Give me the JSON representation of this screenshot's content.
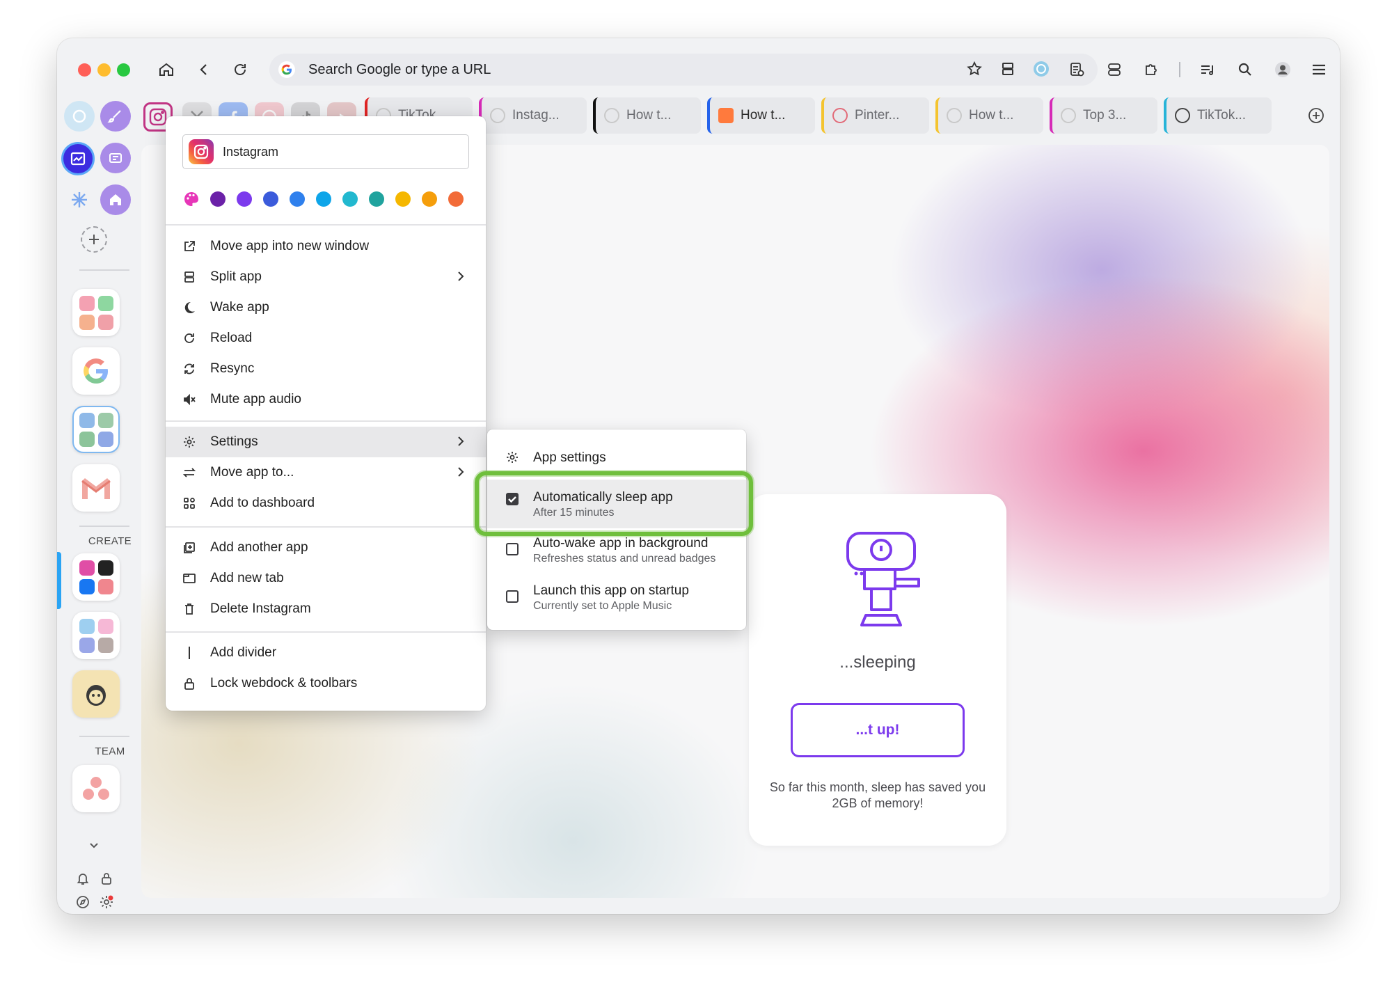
{
  "toolbar": {
    "omnibox_placeholder": "Search Google or type a URL"
  },
  "web_tabs": [
    {
      "label": "TikTok",
      "color": "#e02424"
    },
    {
      "label": "Instag...",
      "color": "#d62ab7"
    },
    {
      "label": "How t...",
      "color": "#111111"
    },
    {
      "label": "How t...",
      "color": "#2563eb"
    },
    {
      "label": "Pinter...",
      "color": "#f4c430"
    },
    {
      "label": "How t...",
      "color": "#f4c430"
    },
    {
      "label": "Top 3...",
      "color": "#d62ab7"
    },
    {
      "label": "TikTok...",
      "color": "#27b4d8"
    }
  ],
  "dock": {
    "create_label": "CREATE",
    "team_label": "TEAM"
  },
  "sleep_card": {
    "title": "...sleeping",
    "button_label": "...t up!",
    "note": "So far this month, sleep has saved you 2GB of memory!"
  },
  "context_menu": {
    "app_name_value": "Instagram",
    "swatch_colors": [
      "#6b21a8",
      "#7c3aed",
      "#3b5bdb",
      "#2f80ed",
      "#0ea5e9",
      "#22b8cf",
      "#20a39e",
      "#f5b700",
      "#f59e0b",
      "#f26b38"
    ],
    "items": {
      "move_window": "Move app into new window",
      "split_app": "Split app",
      "wake_app": "Wake app",
      "reload": "Reload",
      "resync": "Resync",
      "mute": "Mute app audio",
      "settings": "Settings",
      "move_to": "Move app to...",
      "add_dashboard": "Add to dashboard",
      "add_another": "Add another app",
      "add_tab": "Add new tab",
      "delete": "Delete Instagram",
      "add_divider": "Add divider",
      "lock": "Lock webdock & toolbars"
    }
  },
  "settings_submenu": {
    "app_settings": "App settings",
    "auto_sleep": {
      "title": "Automatically sleep app",
      "subtitle": "After 15 minutes",
      "checked": true
    },
    "auto_wake": {
      "title": "Auto-wake app in background",
      "subtitle": "Refreshes status and unread badges",
      "checked": false
    },
    "launch_startup": {
      "title": "Launch this app on startup",
      "subtitle": "Currently set to Apple Music",
      "checked": false
    }
  },
  "colors": {
    "accent_purple": "#7c3aed",
    "highlight_green": "#6fbf3c",
    "active_indicator": "#2aa4f4"
  }
}
